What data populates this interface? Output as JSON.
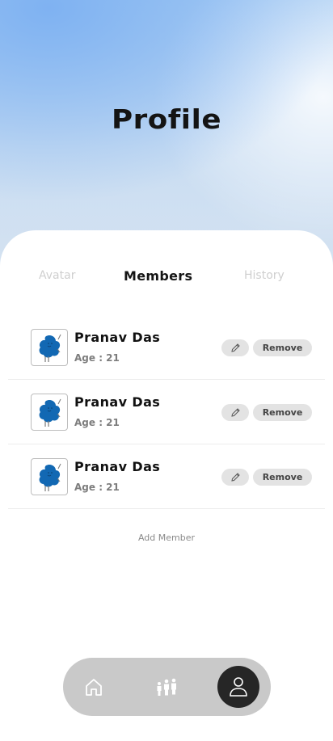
{
  "header": {
    "title": "Profile"
  },
  "tabs": [
    {
      "label": "Avatar",
      "active": false
    },
    {
      "label": "Members",
      "active": true
    },
    {
      "label": "History",
      "active": false
    }
  ],
  "members": [
    {
      "name": "Pranav Das",
      "age": "Age : 21",
      "edit_icon": "pencil-icon",
      "remove_label": "Remove",
      "avatar_icon": "blob-character-avatar"
    },
    {
      "name": "Pranav Das",
      "age": "Age : 21",
      "edit_icon": "pencil-icon",
      "remove_label": "Remove",
      "avatar_icon": "blob-character-avatar"
    },
    {
      "name": "Pranav Das",
      "age": "Age : 21",
      "edit_icon": "pencil-icon",
      "remove_label": "Remove",
      "avatar_icon": "blob-character-avatar"
    }
  ],
  "add_member_label": "Add Member",
  "bottom_nav": {
    "items": [
      {
        "icon": "home-icon",
        "active": false
      },
      {
        "icon": "family-icon",
        "active": false
      },
      {
        "icon": "person-icon",
        "active": true
      }
    ]
  },
  "colors": {
    "avatar_blue": "#1268b3",
    "active_nav": "#262626",
    "nav_bar": "#c9c9c9",
    "button_bg": "#e3e3e3"
  }
}
